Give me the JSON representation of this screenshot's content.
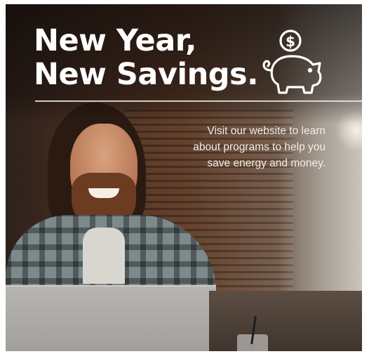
{
  "ad": {
    "headline_line1": "New Year,",
    "headline_line2": "New Savings.",
    "body_lines": [
      "Visit our website to learn",
      "about programs to help you",
      "save energy and money."
    ],
    "icon": "piggy-bank-with-dollar-coin-icon",
    "text_color": "#ffffff"
  }
}
